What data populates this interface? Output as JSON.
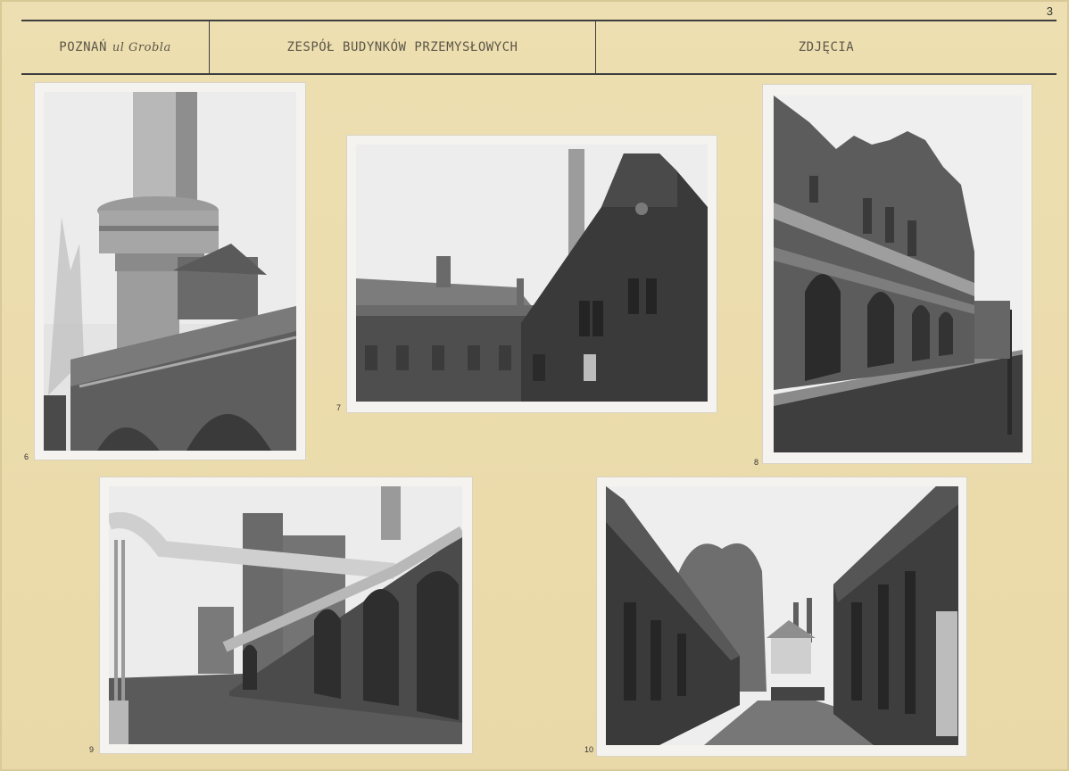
{
  "page_number": "3",
  "header": {
    "location": "POZNAŃ",
    "street_handwritten": "ul Grobla",
    "title": "ZESPÓŁ BUDYNKÓW PRZEMYSŁOWYCH",
    "section": "ZDJĘCIA"
  },
  "photos": [
    {
      "number": "6",
      "subject": "factory chimney with water tower over brick building"
    },
    {
      "number": "7",
      "subject": "brick industrial halls with chimney"
    },
    {
      "number": "8",
      "subject": "ornate brick facade along street"
    },
    {
      "number": "9",
      "subject": "courtyard with overhead pipeline and arched halls"
    },
    {
      "number": "10",
      "subject": "narrow street between brick buildings, church towers in distance"
    }
  ]
}
